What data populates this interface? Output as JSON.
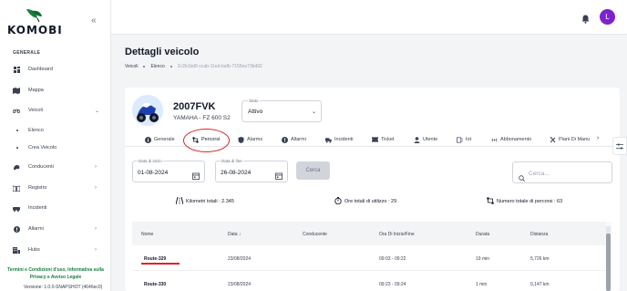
{
  "brand": {
    "name": "KOMOBI"
  },
  "sidebar": {
    "section": "GENERALE",
    "items": [
      {
        "label": "Dashboard",
        "icon": "dashboard-icon"
      },
      {
        "label": "Mappa",
        "icon": "map-icon"
      },
      {
        "label": "Veicoli",
        "icon": "motorcycle-icon",
        "expanded": true
      },
      {
        "label": "Elenco",
        "sub": true
      },
      {
        "label": "Crea Veicolo",
        "sub": true
      },
      {
        "label": "Conducenti",
        "icon": "driver-icon"
      },
      {
        "label": "Registro",
        "icon": "book-icon"
      },
      {
        "label": "Incidenti",
        "icon": "car-crash-icon"
      },
      {
        "label": "Allarmi",
        "icon": "alert-icon"
      },
      {
        "label": "Hubs",
        "icon": "building-icon"
      }
    ],
    "footer_link": "Termini e Condizioni d'uso, Informativa sulla Privacy e Avviso Legale",
    "version": "Versione: 1.0.0-SNAPSHOT (4646ec0)"
  },
  "user": {
    "initial": "L"
  },
  "page": {
    "title": "Dettagli veicolo",
    "breadcrumb": [
      "Veicoli",
      "Elenco",
      "2c2b1bd0-ccab-11ed-bafb-7155ee73bd92"
    ]
  },
  "vehicle": {
    "plate": "2007FVK",
    "model": "YAMAHA - FZ 600 S2",
    "status_label": "Stato",
    "status_value": "Attivo"
  },
  "tabs": [
    {
      "label": "Generale",
      "icon": "info-icon"
    },
    {
      "label": "Percorsi",
      "icon": "route-icon",
      "active": true
    },
    {
      "label": "Alarms",
      "icon": "shield-icon"
    },
    {
      "label": "Allarmi",
      "icon": "alert-circle-icon"
    },
    {
      "label": "Incidenti",
      "icon": "truck-icon"
    },
    {
      "label": "Ticket",
      "icon": "ticket-icon"
    },
    {
      "label": "Utente",
      "icon": "user-icon"
    },
    {
      "label": "Iot",
      "icon": "iot-icon"
    },
    {
      "label": "Abbonamento",
      "icon": "signal-icon"
    },
    {
      "label": "Piani Di Manu",
      "icon": "wrench-icon"
    }
  ],
  "filters": {
    "start_label": "Data di inizio",
    "start_value": "01-08-2024",
    "end_label": "Data di fine",
    "end_value": "26-08-2024",
    "search_button": "Cerca",
    "search_placeholder": "Cerca..."
  },
  "stats": {
    "km": "Kilometri totali : 2.345",
    "hours": "Ore totali di utilizzo : 29",
    "routes": "Numero totale di percorsi : 63"
  },
  "table": {
    "columns": [
      "Nome",
      "Data",
      "Conducente",
      "Ora Di Inizio/Fine",
      "Durata",
      "Distanza"
    ],
    "rows": [
      {
        "name": "Route-329",
        "date": "23/08/2024",
        "driver": "",
        "time": "09:03 - 09:22",
        "duration": "19 min",
        "distance": "5,726 km"
      },
      {
        "name": "Route-330",
        "date": "23/08/2024",
        "driver": "",
        "time": "09:23 - 09:24",
        "duration": "1 min",
        "distance": "0,147 km"
      }
    ]
  },
  "colors": {
    "accent": "#7e22ce",
    "highlight": "#dc2626",
    "brand_green": "#15803d"
  }
}
